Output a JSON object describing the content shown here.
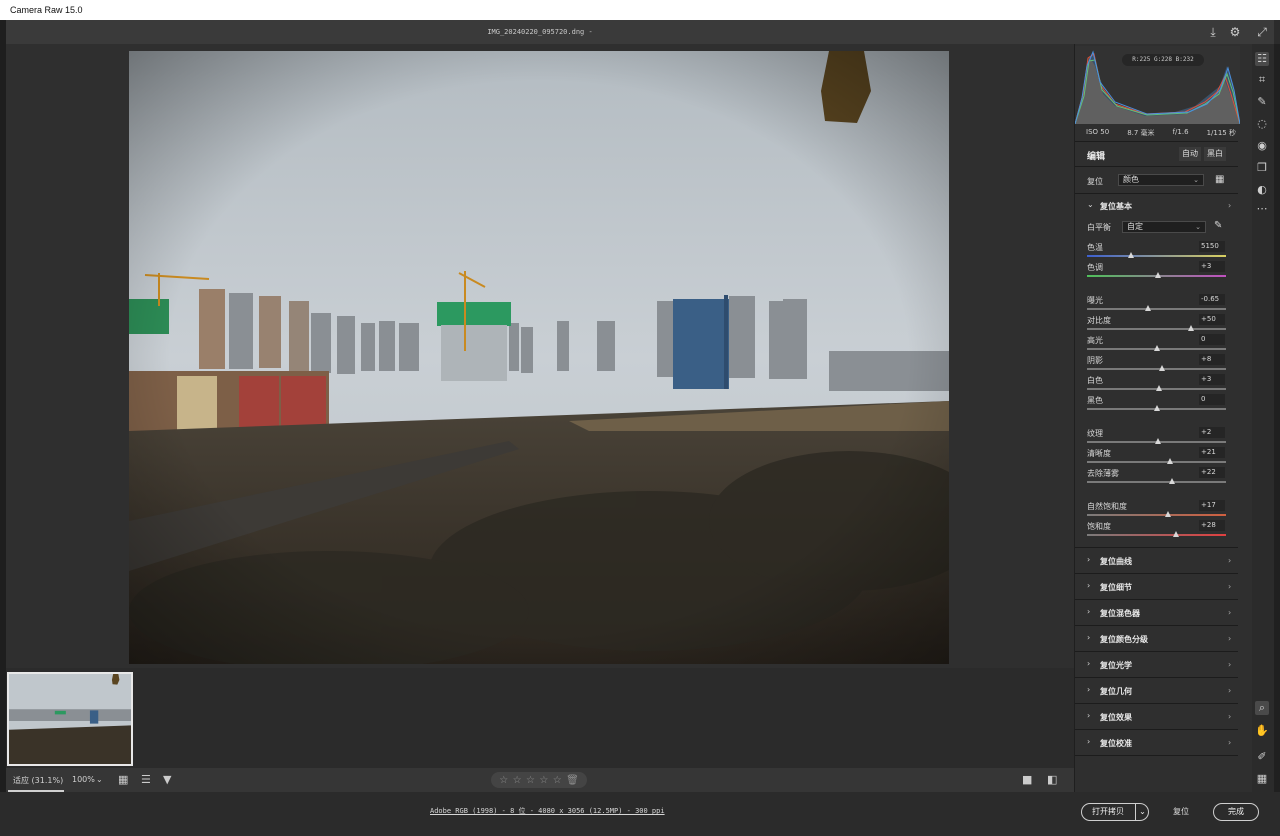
{
  "window": {
    "title": "Camera Raw 15.0"
  },
  "header": {
    "filename": "IMG_20240220_095720.dng -"
  },
  "histogram": {
    "rgb_readout": "R:225  G:228  B:232"
  },
  "camera_info": {
    "iso": "ISO 50",
    "focal": "8.7 毫米",
    "aperture": "f/1.6",
    "shutter": "1/115 秒"
  },
  "panel": {
    "title": "编辑",
    "auto_label": "自动",
    "bw_label": "黑白",
    "profile_label": "复位",
    "profile_value": "颜色",
    "basic_title": "复位基本",
    "wb_label": "白平衡",
    "wb_value": "自定",
    "sliders": [
      {
        "label": "色温",
        "value": "5150",
        "pos": 0.32
      },
      {
        "label": "色调",
        "value": "+3",
        "pos": 0.51
      },
      {
        "label": "曝光",
        "value": "-0.65",
        "pos": 0.44
      },
      {
        "label": "对比度",
        "value": "+50",
        "pos": 0.75
      },
      {
        "label": "高光",
        "value": "0",
        "pos": 0.5
      },
      {
        "label": "阴影",
        "value": "+8",
        "pos": 0.54
      },
      {
        "label": "白色",
        "value": "+3",
        "pos": 0.52
      },
      {
        "label": "黑色",
        "value": "0",
        "pos": 0.5
      },
      {
        "label": "纹理",
        "value": "+2",
        "pos": 0.51
      },
      {
        "label": "清晰度",
        "value": "+21",
        "pos": 0.6
      },
      {
        "label": "去除薄雾",
        "value": "+22",
        "pos": 0.61
      },
      {
        "label": "自然饱和度",
        "value": "+17",
        "pos": 0.58
      },
      {
        "label": "饱和度",
        "value": "+28",
        "pos": 0.64
      }
    ],
    "sections": [
      "复位曲线",
      "复位细节",
      "复位混色器",
      "复位颜色分级",
      "复位光学",
      "复位几何",
      "复位效果",
      "复位校准"
    ]
  },
  "bottom": {
    "zoom_fit": "适应 (31.1%)",
    "zoom_100": "100%",
    "stars": [
      "☆",
      "☆",
      "☆",
      "☆",
      "☆"
    ],
    "file_info": "Adobe RGB (1998) - 8 位 - 4080 x 3056 (12.5MP) - 300 ppi",
    "open_copy": "打开拷贝",
    "reset": "复位",
    "done": "完成"
  }
}
